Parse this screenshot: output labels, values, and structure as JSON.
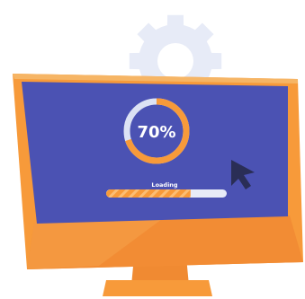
{
  "progress": {
    "percent_label": "70%",
    "fraction": 0.7,
    "loading_label": "Loading",
    "bar_fraction": 0.7
  },
  "icons": {
    "background_icon": "gear-icon",
    "pointer_icon": "mouse-cursor-icon",
    "device_icon": "computer-monitor-icon"
  },
  "colors": {
    "screen": "#4b52b3",
    "monitor_frame": "#f79a3a",
    "monitor_frame_dark": "#e6792a",
    "monitor_top_edge": "#f6b565",
    "gear": "#e7ebf7",
    "ring_track": "#dce2f4",
    "ring_fill": "#f79a3a",
    "percent_text": "#ffffff",
    "label_text": "#ffffff",
    "bar_track": "#e7ebf7",
    "bar_fill": "#f79a3a",
    "bar_stripe": "#fbbd73",
    "cursor": "#2a2e56"
  }
}
